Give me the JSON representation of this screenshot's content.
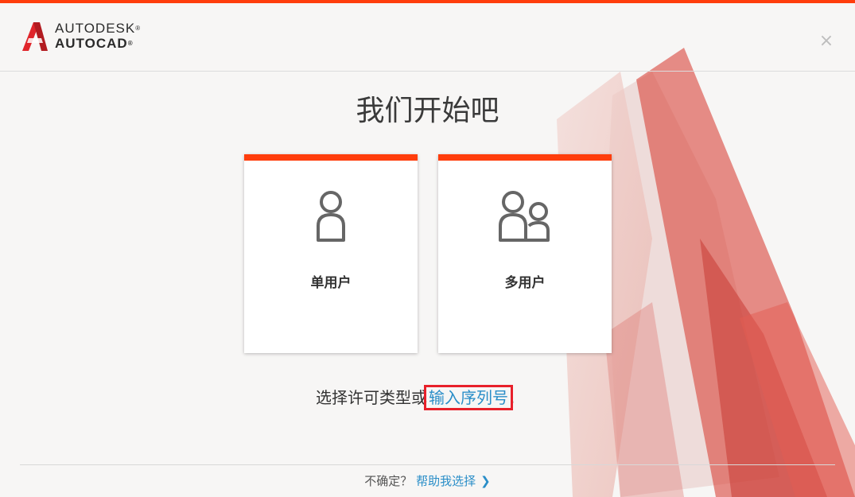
{
  "brand": {
    "line1": "AUTODESK",
    "line2": "AUTOCAD",
    "reg": "®"
  },
  "close_glyph": "×",
  "title": "我们开始吧",
  "cards": [
    {
      "label": "单用户",
      "icon": "single-user-icon"
    },
    {
      "label": "多用户",
      "icon": "multi-user-icon"
    }
  ],
  "prompt": {
    "text": "选择许可类型或",
    "link": "输入序列号",
    "end": "."
  },
  "footer": {
    "question": "不确定？",
    "help": "帮助我选择",
    "chevron": "❯"
  },
  "colors": {
    "accent": "#ff3d0c",
    "link": "#2a8ec8",
    "highlight": "#e8202a"
  }
}
